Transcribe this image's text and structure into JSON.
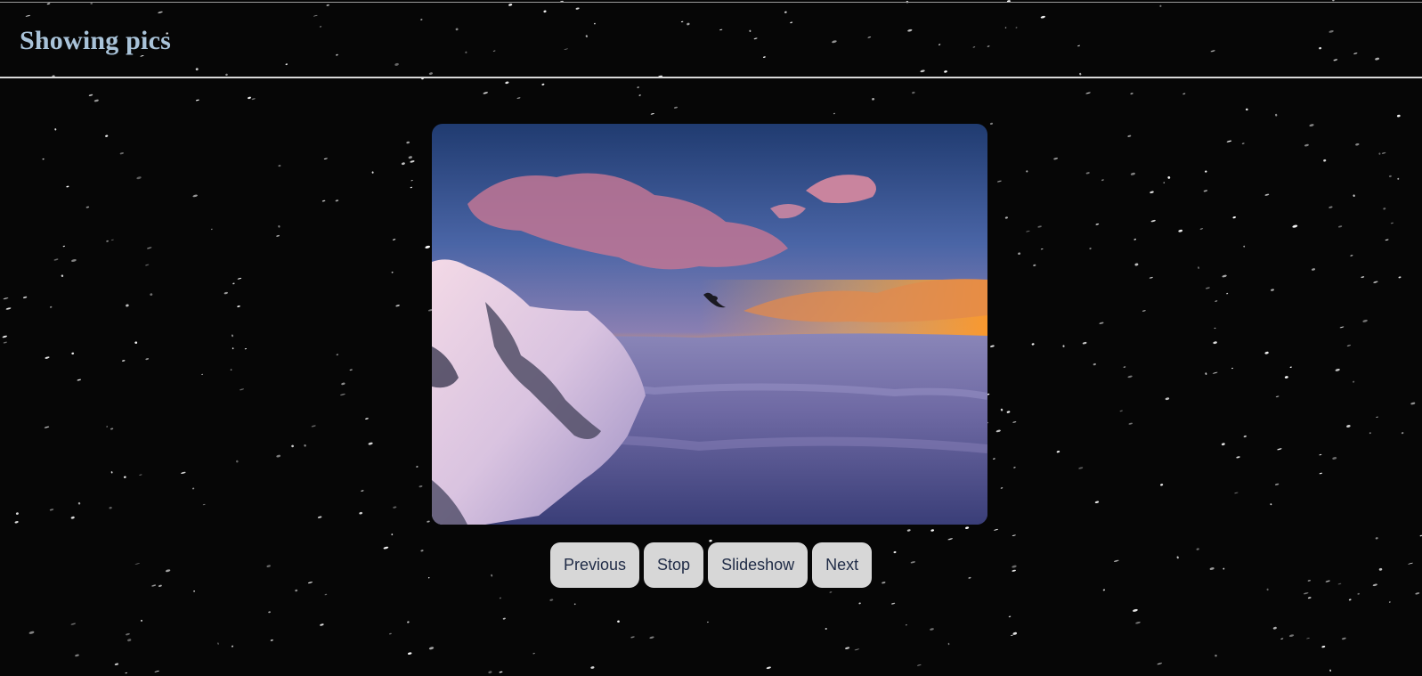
{
  "header": {
    "title": "Showing pics"
  },
  "viewer": {
    "image_subject": "snowy-mountain-sunset-above-clouds-with-bird"
  },
  "controls": {
    "previous_label": "Previous",
    "stop_label": "Stop",
    "slideshow_label": "Slideshow",
    "next_label": "Next"
  },
  "colors": {
    "background": "#060606",
    "title": "#a9c3d9",
    "button_bg": "#d7d7d7",
    "button_text": "#1f2b46",
    "header_rule": "#d8d8d8"
  }
}
